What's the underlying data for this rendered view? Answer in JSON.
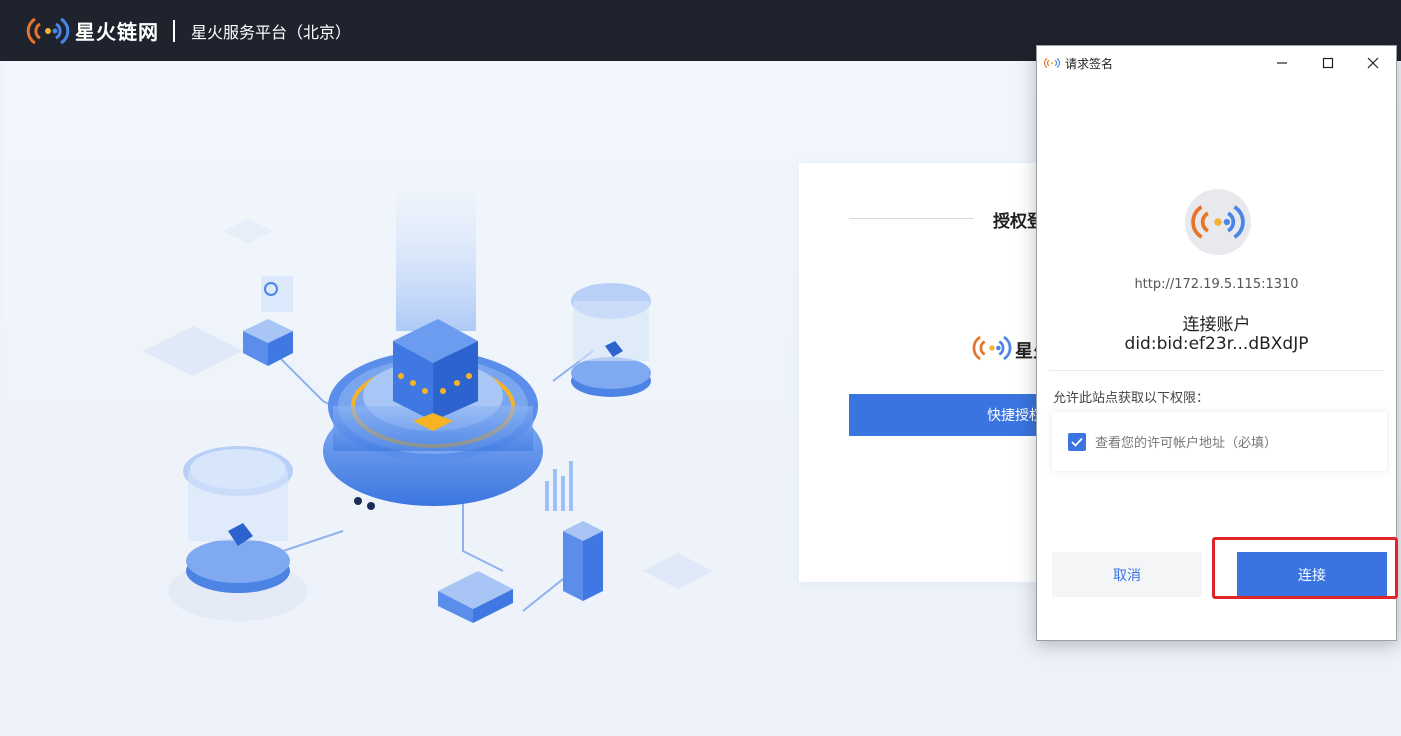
{
  "topbar": {
    "brand_name": "星火链网",
    "platform_name": "星火服务平台（北京）"
  },
  "login_card": {
    "title": "授权登",
    "brand": "星火",
    "quick_button": "快捷授权"
  },
  "dialog": {
    "title": "请求签名",
    "url": "http://172.19.5.115:1310",
    "connect_label": "连接账户",
    "did": "did:bid:ef23r...dBXdJP",
    "permission_label": "允许此站点获取以下权限：",
    "permission_item": "查看您的许可帐户地址（必填）",
    "permission_checked": true,
    "cancel_label": "取消",
    "connect_button": "连接"
  },
  "colors": {
    "topbar": "#1f232e",
    "primary": "#3a74e0",
    "highlight": "#e0262b"
  },
  "icons": [
    "spark-logo-icon",
    "minimize-icon",
    "maximize-icon",
    "close-icon",
    "checkmark-icon"
  ]
}
